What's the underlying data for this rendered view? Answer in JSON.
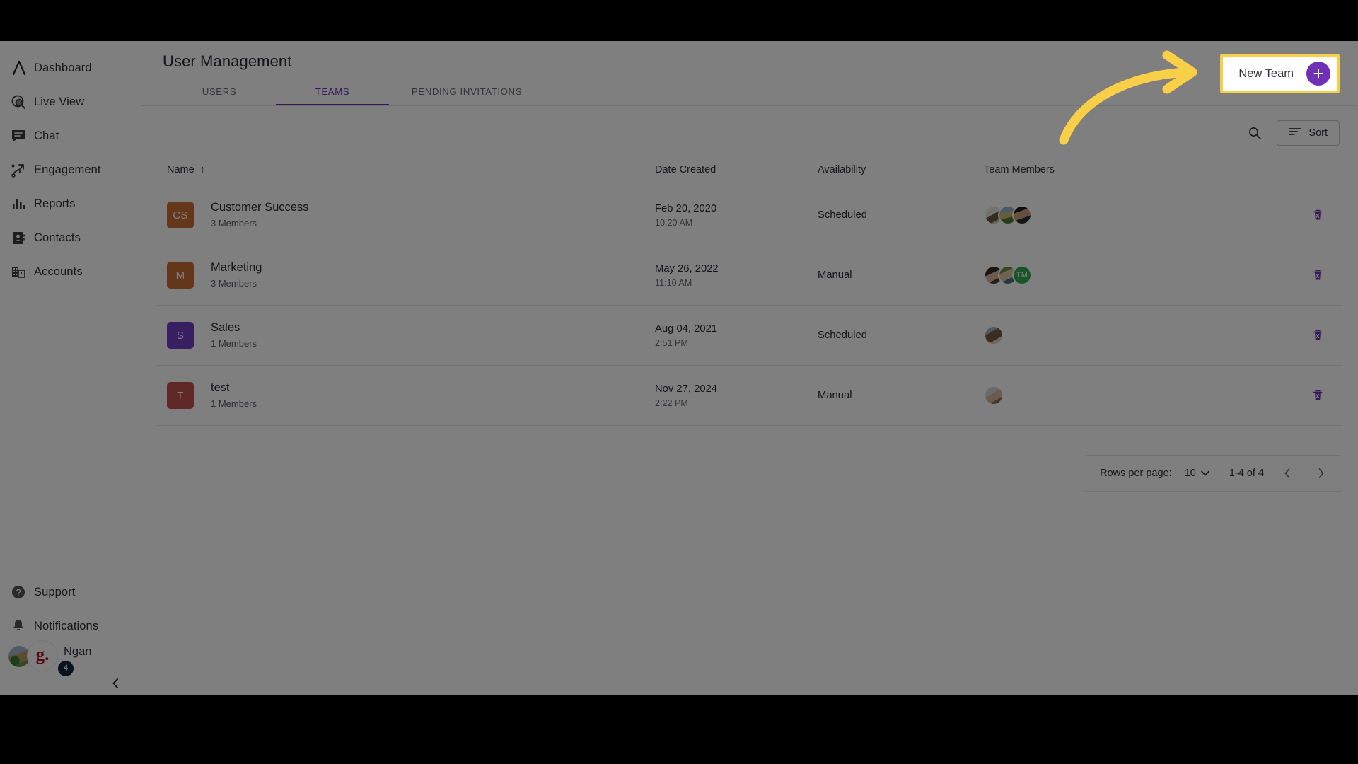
{
  "sidebar": {
    "top_items": [
      {
        "label": "Dashboard",
        "icon": "dashboard-logo-icon"
      },
      {
        "label": "Live View",
        "icon": "live-view-icon"
      },
      {
        "label": "Chat",
        "icon": "chat-icon"
      },
      {
        "label": "Engagement",
        "icon": "engagement-icon"
      },
      {
        "label": "Reports",
        "icon": "reports-bar-chart-icon"
      },
      {
        "label": "Contacts",
        "icon": "contacts-card-icon"
      },
      {
        "label": "Accounts",
        "icon": "accounts-building-icon"
      }
    ],
    "bottom_items": [
      {
        "label": "Support",
        "icon": "question-circle-icon"
      },
      {
        "label": "Notifications",
        "icon": "bell-icon"
      }
    ],
    "profile": {
      "name": "Ngan",
      "brand_initial": "g.",
      "badge_count": "4"
    },
    "collapse_icon": "chevron-left-icon"
  },
  "header": {
    "title": "User Management",
    "tabs": [
      {
        "label": "USERS",
        "active": false
      },
      {
        "label": "TEAMS",
        "active": true
      },
      {
        "label": "PENDING INVITATIONS",
        "active": false
      }
    ],
    "new_team": {
      "label": "New Team",
      "plus_icon": "plus-icon"
    }
  },
  "toolbar": {
    "search_icon": "search-icon",
    "sort_label": "Sort",
    "sort_icon": "sort-lines-icon"
  },
  "table": {
    "columns": [
      {
        "label": "Name",
        "sort_indicator": "↑"
      },
      {
        "label": "Date Created"
      },
      {
        "label": "Availability"
      },
      {
        "label": "Team Members"
      }
    ],
    "rows": [
      {
        "initials": "CS",
        "initials_color": "#c96c35",
        "name": "Customer Success",
        "members_text": "3 Members",
        "date": "Feb 20, 2020",
        "time": "10:20 AM",
        "availability": "Scheduled",
        "avatars": [
          {
            "type": "photo",
            "style": "ph1"
          },
          {
            "type": "photo",
            "style": "ph2"
          },
          {
            "type": "photo",
            "style": "ph3"
          }
        ],
        "delete_icon": "trash-icon"
      },
      {
        "initials": "M",
        "initials_color": "#c96c35",
        "name": "Marketing",
        "members_text": "3 Members",
        "date": "May 26, 2022",
        "time": "11:10 AM",
        "availability": "Manual",
        "avatars": [
          {
            "type": "photo",
            "style": "ph4"
          },
          {
            "type": "photo",
            "style": "ph5"
          },
          {
            "type": "initials",
            "text": "TM",
            "style": "initials-green"
          }
        ],
        "delete_icon": "trash-icon"
      },
      {
        "initials": "S",
        "initials_color": "#6f3fc4",
        "name": "Sales",
        "members_text": "1 Members",
        "date": "Aug 04, 2021",
        "time": "2:51 PM",
        "availability": "Scheduled",
        "avatars": [
          {
            "type": "photo",
            "style": "ph6"
          }
        ],
        "delete_icon": "trash-icon"
      },
      {
        "initials": "T",
        "initials_color": "#c0504d",
        "name": "test",
        "members_text": "1 Members",
        "date": "Nov 27, 2024",
        "time": "2:22 PM",
        "availability": "Manual",
        "avatars": [
          {
            "type": "photo",
            "style": "ph7"
          }
        ],
        "delete_icon": "trash-icon"
      }
    ]
  },
  "pagination": {
    "rows_per_page_label": "Rows per page:",
    "rows_per_page_value": "10",
    "range_text": "1-4 of 4",
    "prev_icon": "chevron-left-icon",
    "next_icon": "chevron-right-icon"
  },
  "annotation": {
    "type": "curved-arrow",
    "color": "#f9cf48",
    "points_to": "new-team-button"
  },
  "colors": {
    "accent_purple": "#6f30b5",
    "highlight_yellow": "#f9cf48"
  }
}
